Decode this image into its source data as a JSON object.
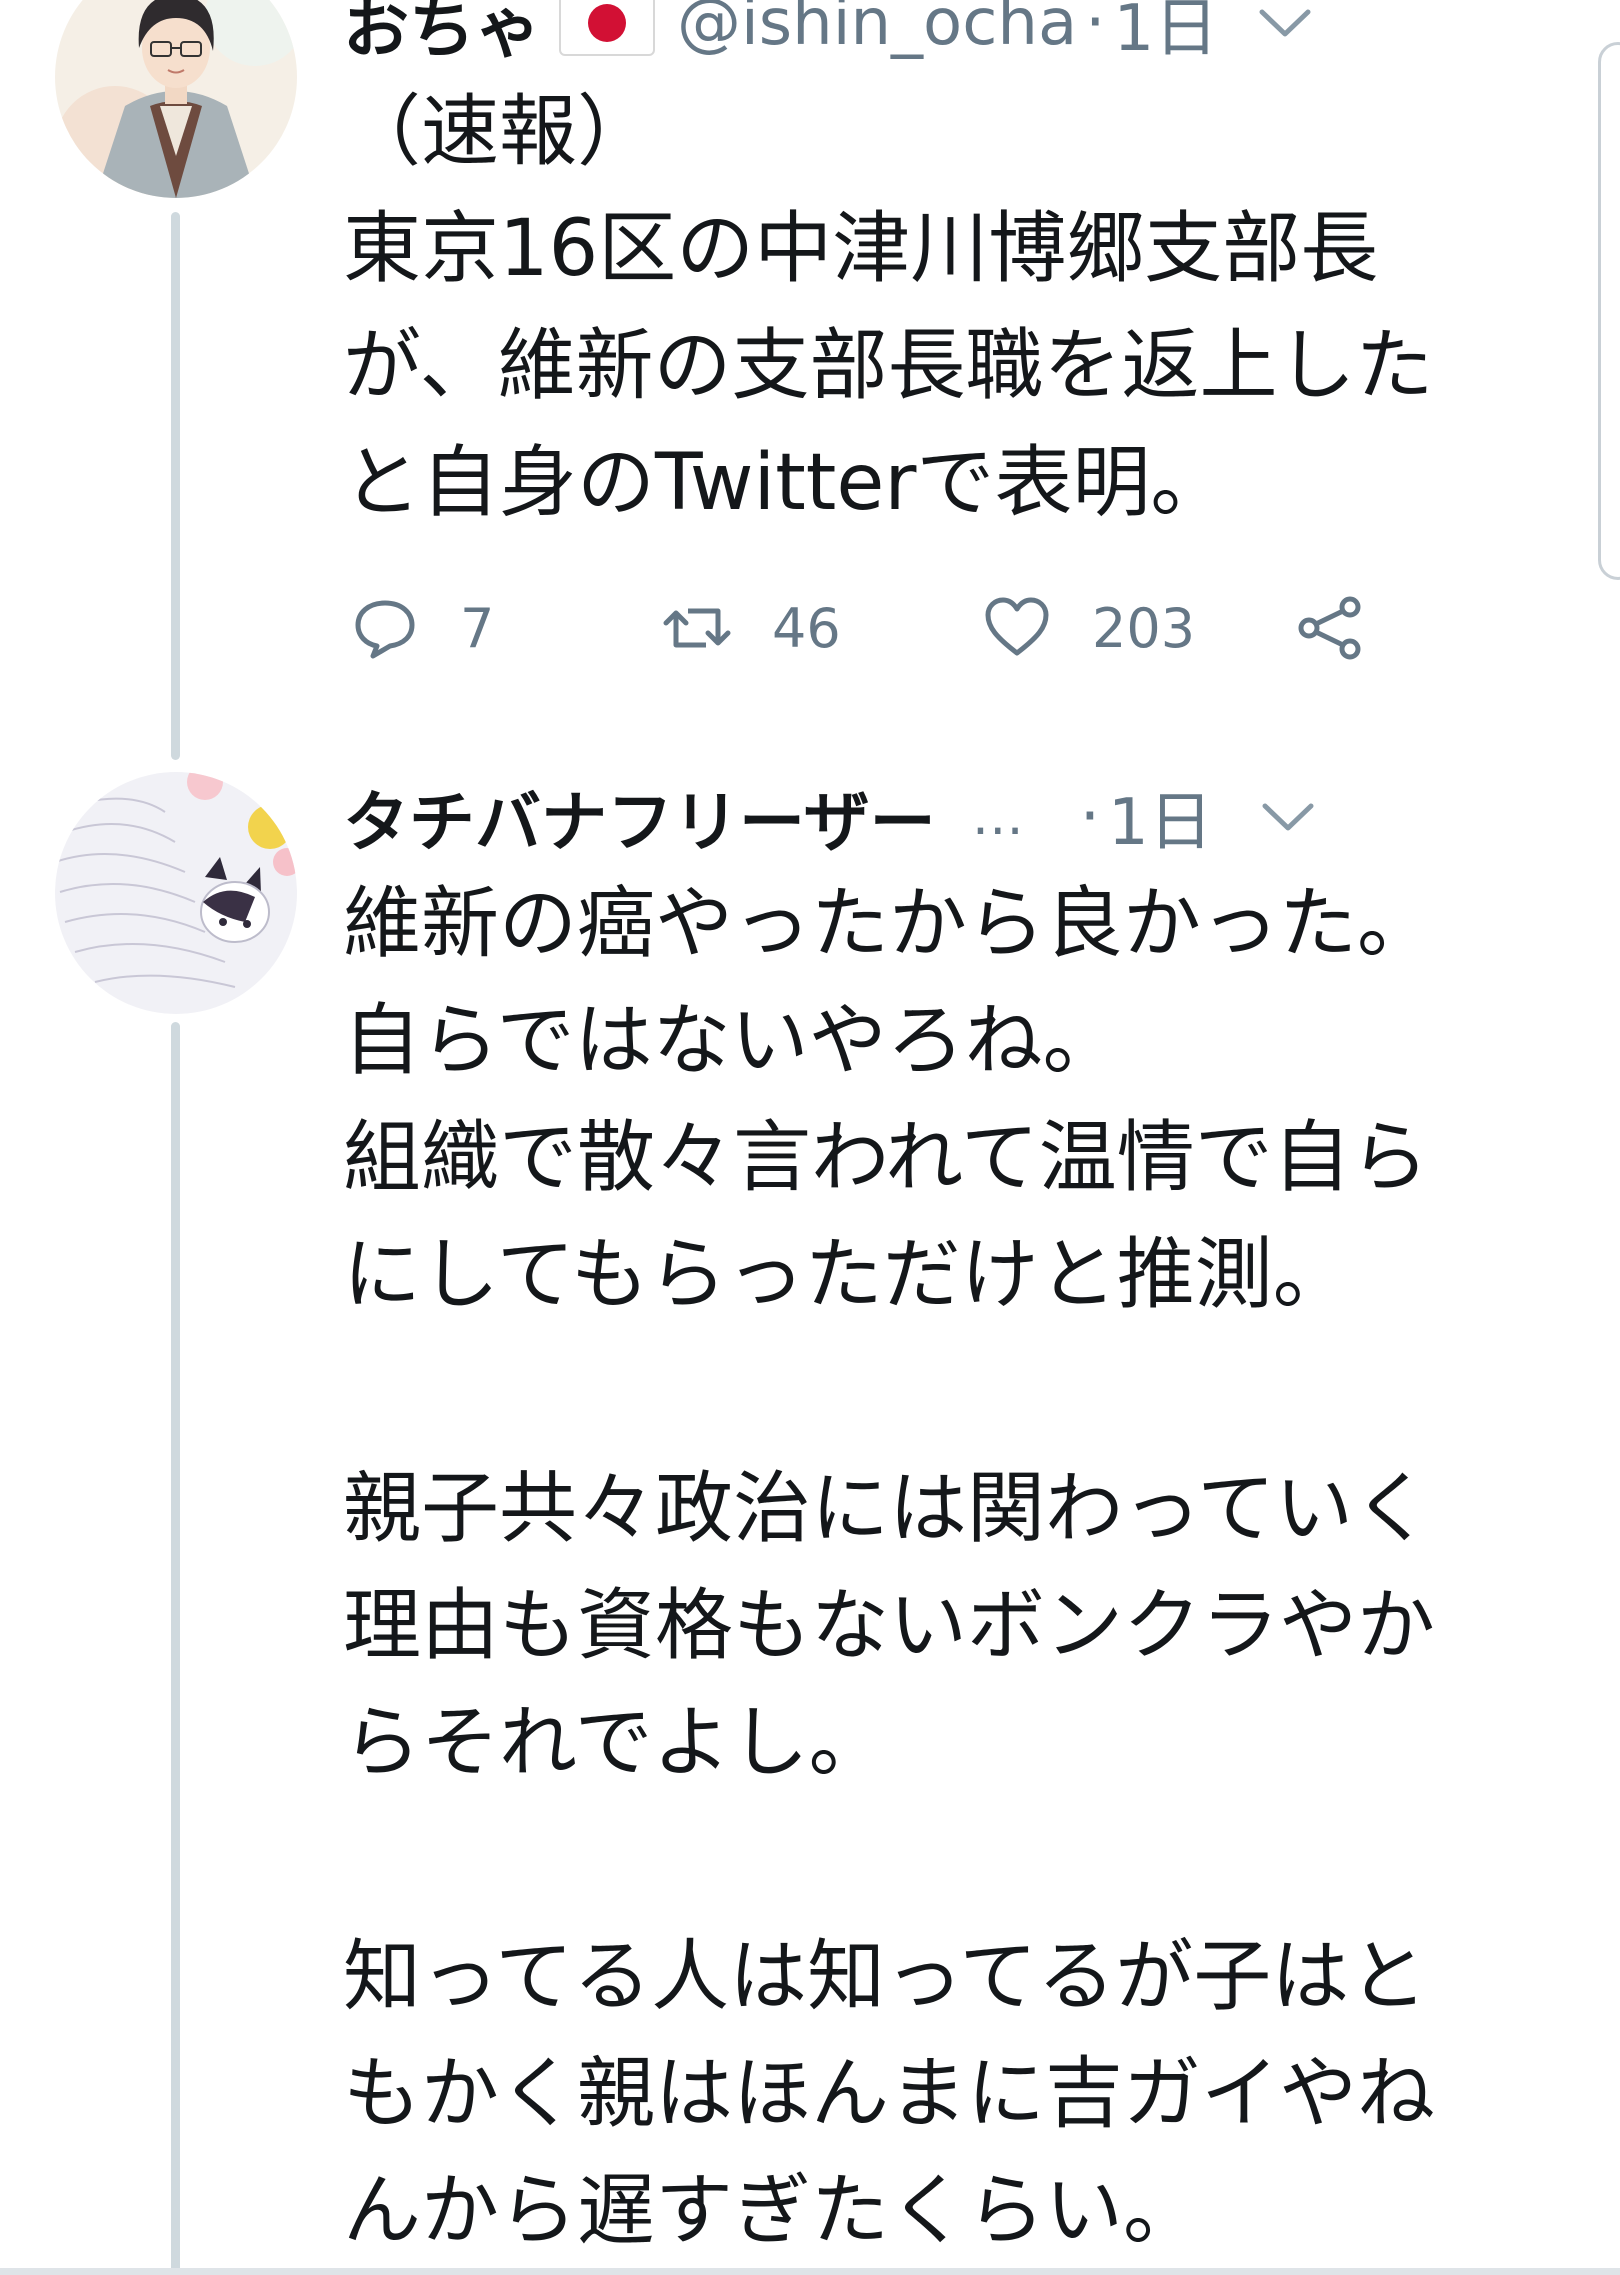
{
  "tweets": [
    {
      "display_name": "おちゃ",
      "flag_icon": "japan-flag-icon",
      "handle": "@ishin_ocha",
      "separator": "·",
      "time": "1日",
      "text": "（速報）\n東京16区の中津川博郷支部長\nが、維新の支部長職を返上した\nと自身のTwitterで表明。",
      "reply_count": "7",
      "retweet_count": "46",
      "like_count": "203",
      "icons": {
        "reply": "reply-icon",
        "retweet": "retweet-icon",
        "like": "heart-icon",
        "share": "share-icon",
        "menu": "chevron-down-icon"
      }
    },
    {
      "display_name": "タチバナフリーザー",
      "ellipsis": "…",
      "separator": "·",
      "time": "1日",
      "text": "維新の癌やったから良かった。\n自らではないやろね。\n組織で散々言われて温情で自ら\nにしてもらっただけと推測。\n\n親子共々政治には関わっていく\n理由も資格もないボンクラやか\nらそれでよし。\n\n知ってる人は知ってるが子はと\nもかく親はほんまに吉ガイやね\nんから遅すぎたくらい。",
      "icons": {
        "menu": "chevron-down-icon"
      }
    }
  ],
  "colors": {
    "text": "#14171a",
    "secondary": "#657786",
    "thread_line": "#cfd9de",
    "flag_red": "#d21034"
  }
}
